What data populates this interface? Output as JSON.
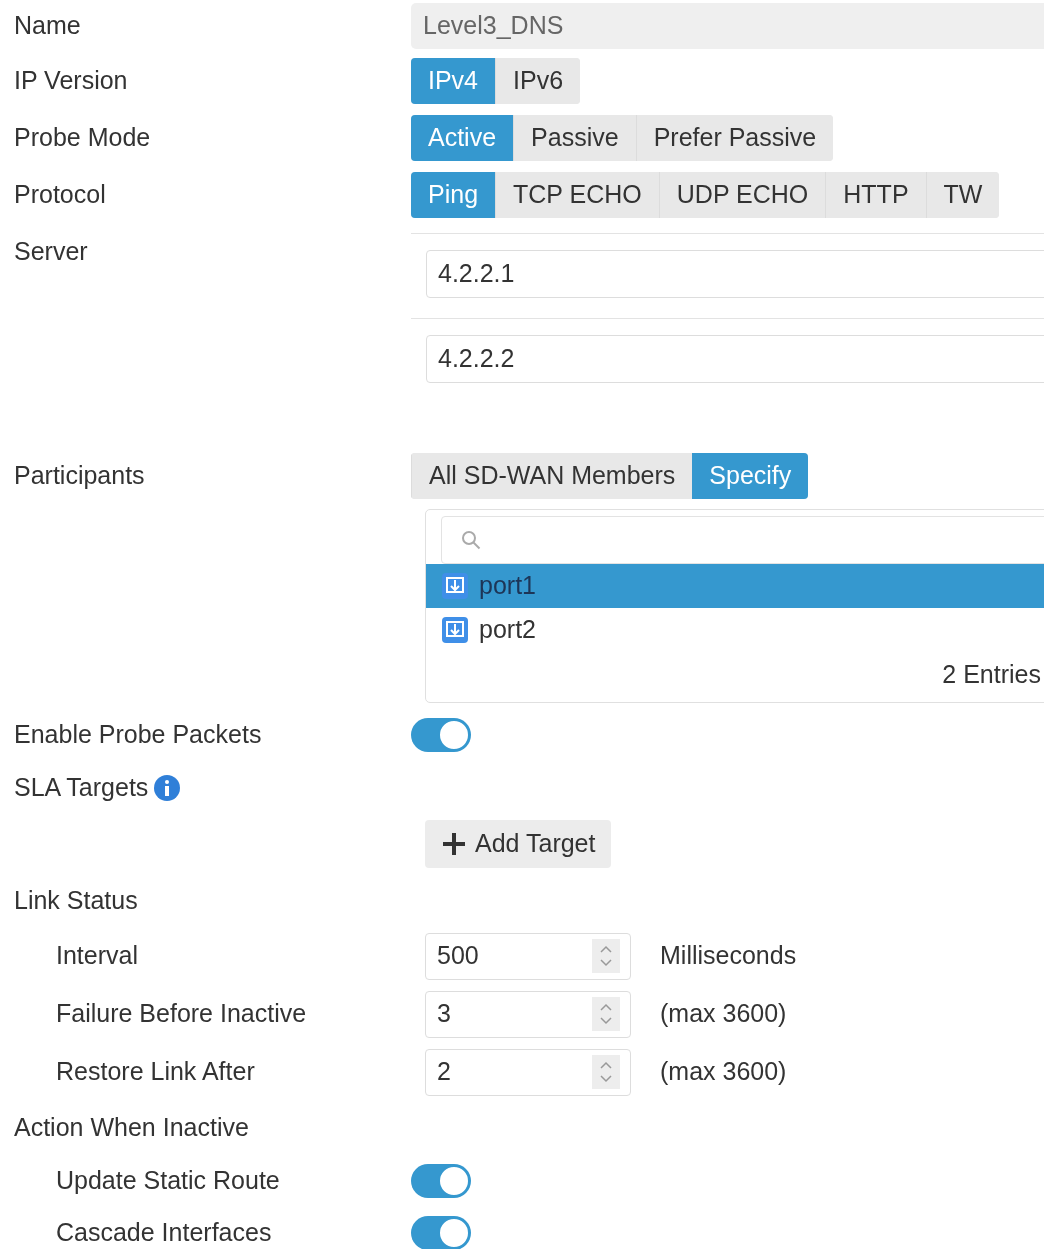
{
  "name": {
    "label": "Name",
    "value": "Level3_DNS"
  },
  "ip_version": {
    "label": "IP Version",
    "options": [
      {
        "label": "IPv4",
        "selected": true
      },
      {
        "label": "IPv6",
        "selected": false
      }
    ]
  },
  "probe_mode": {
    "label": "Probe Mode",
    "options": [
      {
        "label": "Active",
        "selected": true
      },
      {
        "label": "Passive",
        "selected": false
      },
      {
        "label": "Prefer Passive",
        "selected": false
      }
    ]
  },
  "protocol": {
    "label": "Protocol",
    "options": [
      {
        "label": "Ping",
        "selected": true
      },
      {
        "label": "TCP ECHO",
        "selected": false
      },
      {
        "label": "UDP ECHO",
        "selected": false
      },
      {
        "label": "HTTP",
        "selected": false
      },
      {
        "label": "TW",
        "selected": false
      }
    ]
  },
  "server": {
    "label": "Server",
    "values": [
      "4.2.2.1",
      "4.2.2.2"
    ]
  },
  "participants": {
    "label": "Participants",
    "options": [
      {
        "label": "All SD-WAN Members",
        "selected": false
      },
      {
        "label": "Specify",
        "selected": true
      }
    ],
    "items": [
      {
        "name": "port1",
        "selected": true
      },
      {
        "name": "port2",
        "selected": false
      }
    ],
    "count": "2 Entries"
  },
  "enable_probe_packets": {
    "label": "Enable Probe Packets",
    "on": true
  },
  "sla_targets": {
    "label": "SLA Targets",
    "add_button": "Add Target"
  },
  "link_status": {
    "label": "Link Status",
    "fields": [
      {
        "label": "Interval",
        "value": "500",
        "unit": "Milliseconds"
      },
      {
        "label": "Failure Before Inactive",
        "value": "3",
        "unit": "(max 3600)"
      },
      {
        "label": "Restore Link After",
        "value": "2",
        "unit": "(max 3600)"
      }
    ]
  },
  "action_when_inactive": {
    "label": "Action When Inactive",
    "toggles": [
      {
        "label": "Update Static Route",
        "on": true
      },
      {
        "label": "Cascade Interfaces",
        "on": true
      }
    ]
  }
}
